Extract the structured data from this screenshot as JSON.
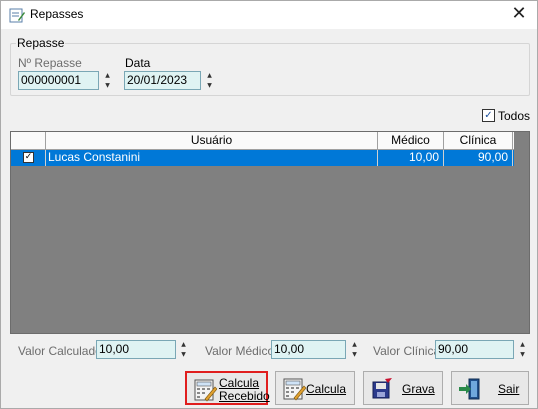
{
  "window": {
    "title": "Repasses",
    "icon": "form-edit-icon",
    "close_glyph": "✕"
  },
  "repasse_group": {
    "legend": "Repasse",
    "numero_label": "Nº Repasse",
    "numero_value": "000000001",
    "data_label": "Data",
    "data_value": "20/01/2023"
  },
  "todos": {
    "label": "Todos",
    "checked": true,
    "check_glyph": "✓"
  },
  "grid": {
    "columns": [
      "Usuário",
      "Médico",
      "Clínica"
    ],
    "rows": [
      {
        "checked": true,
        "usuario": "Lucas Constanini",
        "medico": "10,00",
        "clinica": "90,00"
      }
    ]
  },
  "totals": {
    "calculado_label": "Valor Calculado",
    "calculado_value": "10,00",
    "medico_label": "Valor Médico",
    "medico_value": "10,00",
    "clinica_label": "Valor Clínica",
    "clinica_value": "90,00"
  },
  "buttons": {
    "calcula_recebido_line1": "Calcula",
    "calcula_recebido_line2": "Recebido",
    "calcula": "Calcula",
    "grava": "Grava",
    "sair": "Sair"
  },
  "spin_glyphs": {
    "up": "▲",
    "down": "▼"
  },
  "colors": {
    "selection": "#0078d7",
    "edit_bg": "#dff3f3",
    "grid_bg": "#808080",
    "highlight_border": "#e01e1e"
  }
}
